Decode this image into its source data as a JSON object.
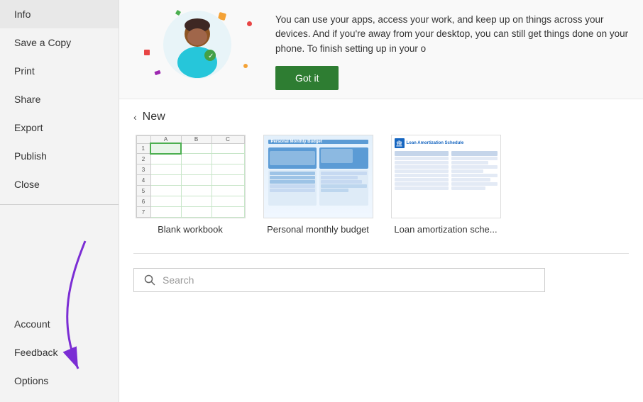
{
  "sidebar": {
    "items": [
      {
        "id": "info",
        "label": "Info"
      },
      {
        "id": "save-copy",
        "label": "Save a Copy"
      },
      {
        "id": "print",
        "label": "Print"
      },
      {
        "id": "share",
        "label": "Share"
      },
      {
        "id": "export",
        "label": "Export"
      },
      {
        "id": "publish",
        "label": "Publish"
      },
      {
        "id": "close",
        "label": "Close"
      }
    ],
    "bottom_items": [
      {
        "id": "account",
        "label": "Account"
      },
      {
        "id": "feedback",
        "label": "Feedback"
      },
      {
        "id": "options",
        "label": "Options"
      }
    ]
  },
  "banner": {
    "description": "You can use your apps, access your work, and keep up on things across your devices. And if you're away from your desktop, you can still get things done on your phone. To finish setting up in your o",
    "got_it_label": "Got it"
  },
  "new_section": {
    "label": "New",
    "templates": [
      {
        "id": "blank-workbook",
        "label": "Blank workbook"
      },
      {
        "id": "personal-monthly-budget",
        "label": "Personal monthly budget"
      },
      {
        "id": "loan-amortization",
        "label": "Loan amortization sche..."
      }
    ]
  },
  "search": {
    "placeholder": "Search",
    "icon": "search-icon"
  }
}
